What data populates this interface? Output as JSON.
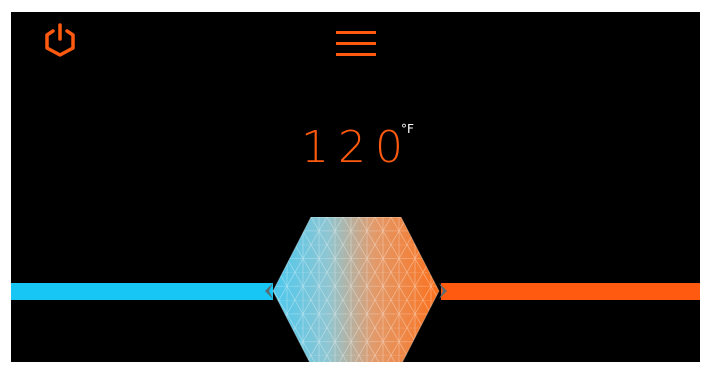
{
  "header": {
    "power_icon": "power-icon",
    "menu_icon": "hamburger-menu-icon"
  },
  "temperature": {
    "value": "120",
    "unit": "°F"
  },
  "slider": {
    "cool_color": "#17c6f5",
    "heat_color": "#ff5a0f",
    "knob_icon": "hexagon-knob"
  },
  "colors": {
    "accent": "#ff5a0f",
    "background": "#000000",
    "cool": "#17c6f5"
  }
}
